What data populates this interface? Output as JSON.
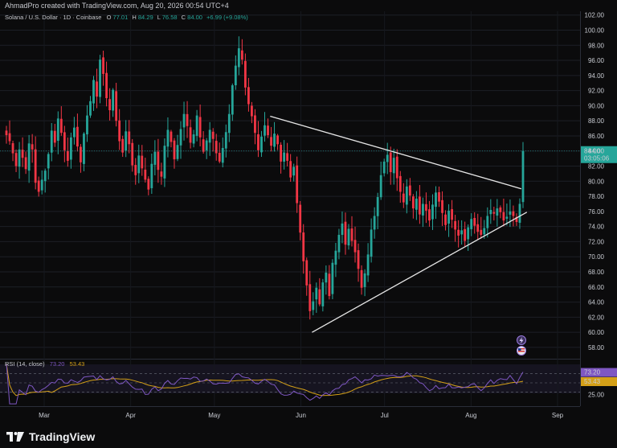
{
  "header": {
    "created_text": "AhmadPro created with TradingView.com, Aug 20, 2026 00:54 UTC+4"
  },
  "legend": {
    "symbol": "Solana / U.S. Dollar · 1D · Coinbase",
    "open_label": "O",
    "open": "77.01",
    "high_label": "H",
    "high": "84.29",
    "low_label": "L",
    "low": "76.58",
    "close_label": "C",
    "close": "84.00",
    "change": "+6.99 (+9.08%)"
  },
  "price_tag": {
    "price": "84.00",
    "countdown": "03:05:06"
  },
  "rsi": {
    "label": "RSI (14, close)",
    "value_rsi": "73.20",
    "value_ma": "53.43",
    "tag_rsi": "73.20",
    "tag_ma": "53.43",
    "level_low": "25.00"
  },
  "footer": {
    "brand": "TradingView"
  },
  "colors": {
    "up": "#26a69a",
    "down": "#f23645",
    "rsi_line": "#7e57c2",
    "rsi_ma": "#d4a017",
    "price_line": "#26a69a",
    "trend_line": "#e6e6e6"
  },
  "icons": [
    "lightning-icon",
    "flag-us-icon",
    "tradingview-logo-icon"
  ],
  "chart_data": {
    "type": "candlestick",
    "title": "Solana / U.S. Dollar · 1D · Coinbase",
    "y_ticks": [
      "58.00",
      "60.00",
      "62.00",
      "64.00",
      "66.00",
      "68.00",
      "70.00",
      "72.00",
      "74.00",
      "76.00",
      "78.00",
      "80.00",
      "82.00",
      "84.00",
      "86.00",
      "88.00",
      "90.00",
      "92.00",
      "94.00",
      "96.00",
      "98.00",
      "100.00",
      "102.00"
    ],
    "ylim": [
      56.5,
      102.5
    ],
    "x_ticks": [
      "Mar",
      "Apr",
      "May",
      "Jun",
      "Jul",
      "Aug",
      "Sep"
    ],
    "last_close": 84.0,
    "trendlines": [
      {
        "name": "upper",
        "from": [
          "2026-05-21",
          88.6
        ],
        "to": [
          "2026-08-19",
          79.0
        ]
      },
      {
        "name": "lower",
        "from": [
          "2026-06-05",
          60.0
        ],
        "to": [
          "2026-08-21",
          75.9
        ]
      }
    ],
    "candles_close": [
      86.1,
      85.3,
      83.7,
      82.0,
      84.2,
      83.1,
      81.6,
      85.0,
      84.2,
      79.8,
      78.6,
      80.2,
      81.4,
      83.6,
      86.7,
      85.1,
      88.3,
      86.4,
      84.1,
      82.7,
      85.8,
      87.1,
      84.6,
      82.5,
      86.3,
      88.7,
      90.6,
      93.4,
      91.2,
      96.1,
      94.2,
      91.0,
      89.4,
      92.1,
      88.0,
      85.3,
      83.8,
      86.6,
      84.9,
      82.1,
      80.8,
      83.4,
      81.7,
      80.2,
      78.9,
      82.3,
      83.9,
      81.5,
      80.6,
      84.7,
      86.8,
      85.2,
      82.9,
      84.8,
      86.9,
      88.9,
      87.3,
      85.1,
      86.2,
      88.7,
      85.8,
      83.9,
      85.4,
      86.8,
      85.6,
      83.7,
      82.6,
      84.4,
      86.5,
      88.9,
      92.7,
      95.3,
      97.6,
      96.1,
      92.4,
      90.2,
      88.6,
      86.4,
      84.1,
      85.9,
      87.4,
      86.1,
      84.7,
      86.3,
      84.9,
      82.6,
      83.8,
      82.7,
      80.5,
      81.9,
      77.1,
      73.2,
      69.4,
      66.2,
      62.8,
      64.1,
      65.9,
      63.7,
      66.6,
      67.9,
      64.8,
      69.2,
      70.8,
      72.9,
      74.4,
      71.6,
      73.7,
      72.1,
      70.6,
      68.4,
      65.9,
      67.8,
      70.3,
      73.6,
      75.4,
      77.9,
      80.8,
      82.6,
      83.5,
      81.2,
      83.1,
      80.4,
      78.6,
      77.2,
      79.3,
      78.1,
      76.4,
      77.7,
      75.6,
      77.0,
      76.1,
      74.8,
      76.9,
      78.5,
      77.3,
      75.8,
      74.2,
      76.1,
      74.9,
      73.6,
      72.8,
      73.5,
      72.1,
      73.9,
      75.0,
      74.1,
      73.3,
      72.9,
      73.8,
      75.4,
      76.2,
      75.7,
      76.4,
      75.9,
      74.8,
      75.3,
      76.0,
      75.4,
      74.6,
      77.0,
      84.0
    ],
    "rsi_series": {
      "name": "RSI (14, close)",
      "last": 73.2,
      "ma_last": 53.43,
      "levels": [
        70,
        50,
        30
      ]
    }
  }
}
